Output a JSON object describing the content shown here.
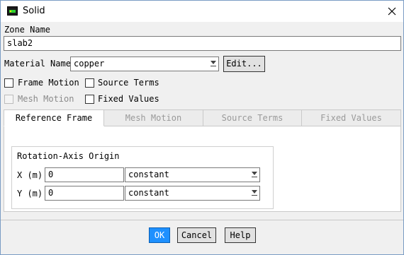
{
  "window": {
    "title": "Solid",
    "icon": "fluent-app-icon",
    "close_icon": "close-icon"
  },
  "zone": {
    "label": "Zone Name",
    "value": "slab2"
  },
  "material": {
    "label": "Material Name",
    "value": "copper",
    "edit_label": "Edit..."
  },
  "options": {
    "frame_motion": {
      "label": "Frame Motion",
      "checked": false,
      "enabled": true
    },
    "source_terms": {
      "label": "Source Terms",
      "checked": false,
      "enabled": true
    },
    "mesh_motion": {
      "label": "Mesh Motion",
      "checked": false,
      "enabled": false
    },
    "fixed_values": {
      "label": "Fixed Values",
      "checked": false,
      "enabled": true
    }
  },
  "tabs": [
    {
      "label": "Reference Frame",
      "active": true
    },
    {
      "label": "Mesh Motion",
      "active": false
    },
    {
      "label": "Source Terms",
      "active": false
    },
    {
      "label": "Fixed Values",
      "active": false
    }
  ],
  "rotation_origin": {
    "title": "Rotation-Axis Origin",
    "x": {
      "label": "X (m)",
      "value": "0",
      "method": "constant"
    },
    "y": {
      "label": "Y (m)",
      "value": "0",
      "method": "constant"
    }
  },
  "buttons": {
    "ok": "OK",
    "cancel": "Cancel",
    "help": "Help"
  },
  "colors": {
    "primary_button": "#1e90ff",
    "window_border": "#7a9cc4"
  }
}
